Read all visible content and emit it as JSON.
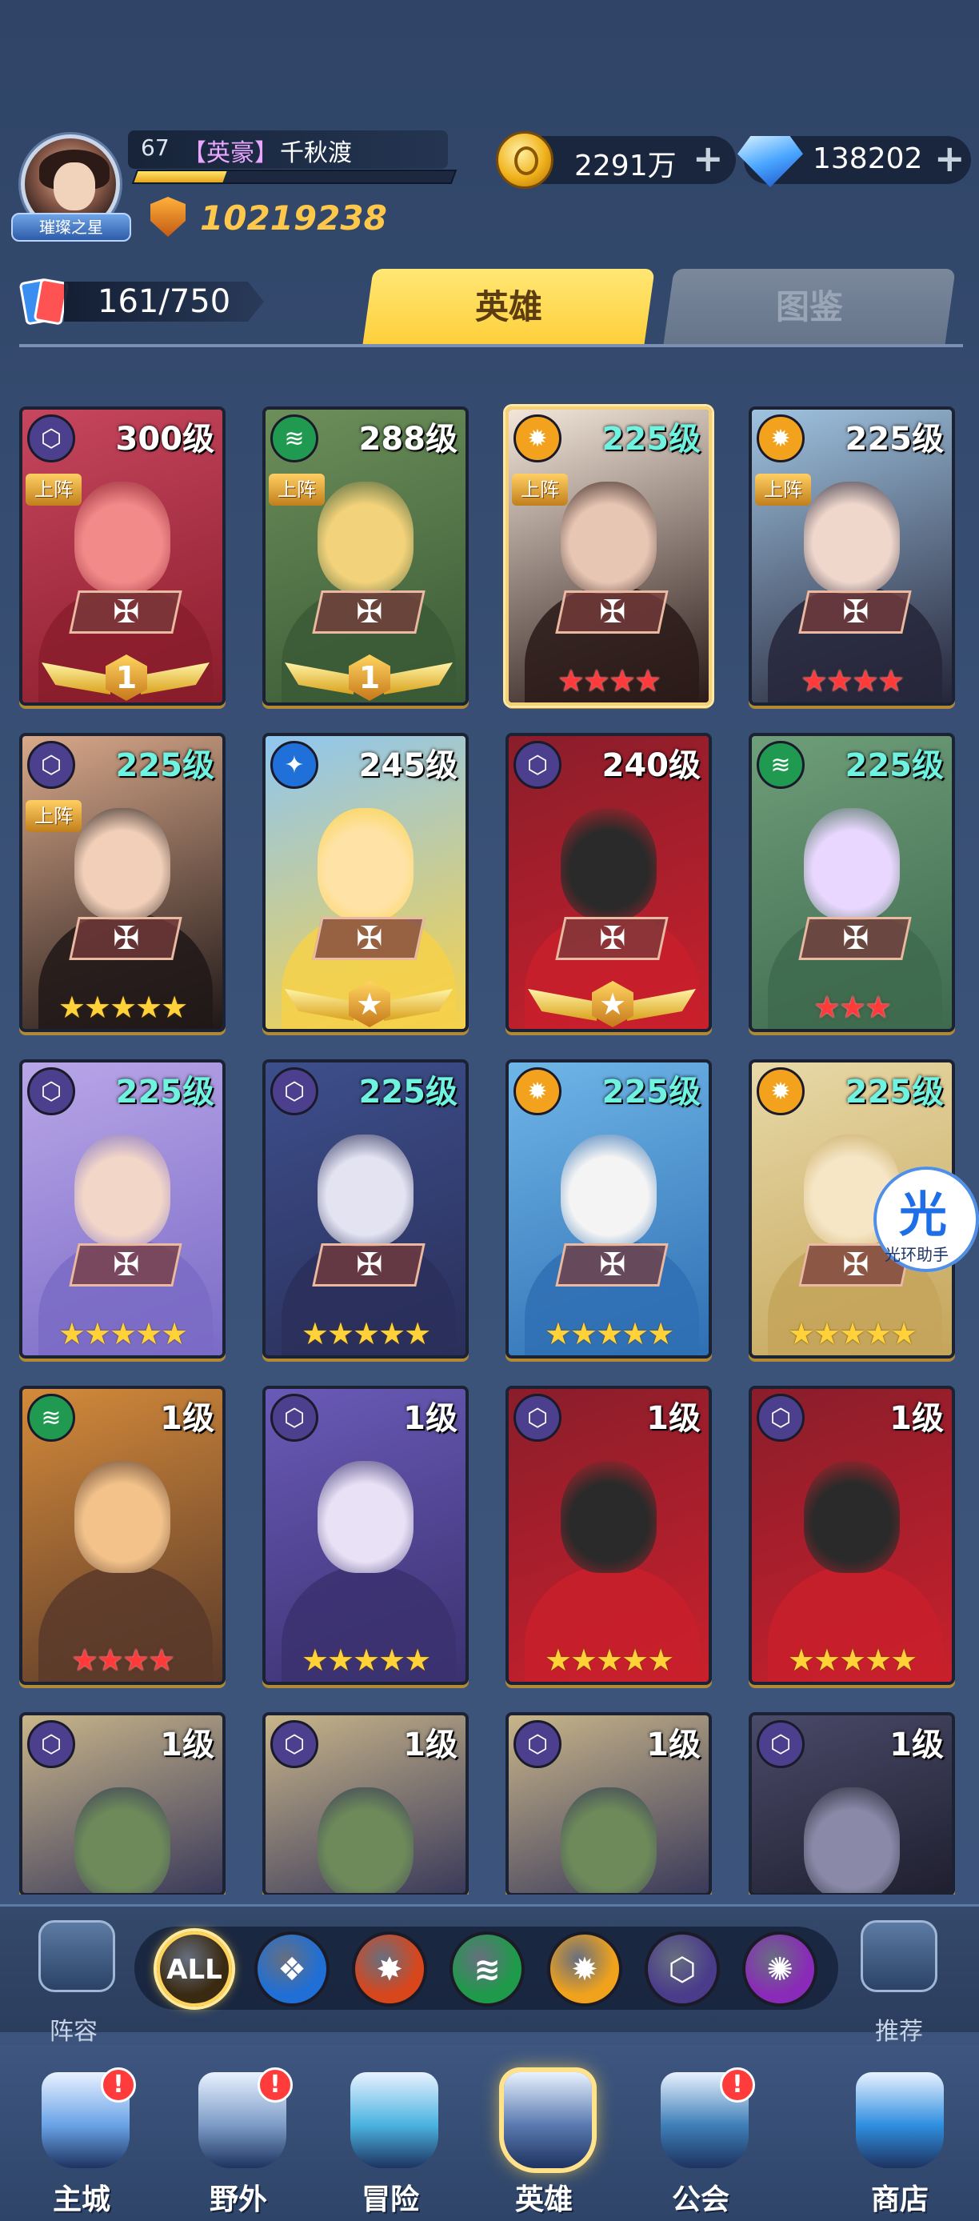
{
  "player": {
    "avatar_badge": "璀璨之星",
    "level": "67",
    "title": "【英豪】",
    "name": "千秋渡",
    "xp_fraction": 0.28,
    "power": "10219238"
  },
  "currencies": {
    "gold": "2291万",
    "gems": "138202",
    "plus_label": "+"
  },
  "collection": {
    "count": "161/750"
  },
  "tabs": [
    {
      "label": "英雄",
      "active": true
    },
    {
      "label": "图鉴",
      "active": false
    }
  ],
  "deployed_label": "上阵",
  "heroes": [
    {
      "level": "300级",
      "faction": "void",
      "deployed": true,
      "rank": "wings",
      "rank_value": "1",
      "palette": [
        "#c7465f",
        "#f28a8a",
        "#8a1d2b"
      ],
      "level_color": "white"
    },
    {
      "level": "288级",
      "faction": "wind",
      "deployed": true,
      "rank": "wings",
      "rank_value": "1",
      "palette": [
        "#6c8f5a",
        "#f2d27a",
        "#3a5a36"
      ],
      "level_color": "white"
    },
    {
      "level": "225级",
      "faction": "light",
      "deployed": true,
      "rank": "red",
      "stars": 4,
      "palette": [
        "#f3e6d9",
        "#e8c6b4",
        "#2a1a18"
      ],
      "level_color": "teal",
      "selected": true
    },
    {
      "level": "225级",
      "faction": "light",
      "deployed": true,
      "rank": "red",
      "stars": 4,
      "palette": [
        "#9fc3e0",
        "#f0d7cc",
        "#26263a"
      ],
      "level_color": "white"
    },
    {
      "level": "225级",
      "faction": "void",
      "deployed": true,
      "rank": "gold",
      "stars": 5,
      "palette": [
        "#d8a88a",
        "#f2cfb8",
        "#201818"
      ],
      "level_color": "teal"
    },
    {
      "level": "245级",
      "faction": "water",
      "deployed": false,
      "rank": "wings",
      "rank_value": "★",
      "palette": [
        "#8fc6f0",
        "#ffe3a6",
        "#f6d14a"
      ],
      "level_color": "white"
    },
    {
      "level": "240级",
      "faction": "void",
      "deployed": false,
      "rank": "wings",
      "rank_value": "★",
      "palette": [
        "#8a1d2b",
        "#2a2a2a",
        "#c8202c"
      ],
      "level_color": "white"
    },
    {
      "level": "225级",
      "faction": "wind",
      "deployed": false,
      "rank": "red",
      "stars": 3,
      "palette": [
        "#6f9e7a",
        "#e9d7ff",
        "#3e6a4e"
      ],
      "level_color": "teal"
    },
    {
      "level": "225级",
      "faction": "void",
      "deployed": false,
      "rank": "gold",
      "stars": 5,
      "palette": [
        "#b9a6e8",
        "#f2d6c8",
        "#7a6bc6"
      ],
      "level_color": "teal"
    },
    {
      "level": "225级",
      "faction": "void",
      "deployed": false,
      "rank": "gold",
      "stars": 5,
      "palette": [
        "#3d4f8c",
        "#e3e3f2",
        "#2a2f5a"
      ],
      "level_color": "teal"
    },
    {
      "level": "225级",
      "faction": "light",
      "deployed": false,
      "rank": "gold",
      "stars": 5,
      "palette": [
        "#6fb6e8",
        "#f4f4f4",
        "#2f6fb3"
      ],
      "level_color": "teal"
    },
    {
      "level": "225级",
      "faction": "light",
      "deployed": false,
      "rank": "gold",
      "stars": 5,
      "palette": [
        "#e8d9a8",
        "#f6e6c6",
        "#c4a55a"
      ],
      "level_color": "teal"
    },
    {
      "level": "1级",
      "faction": "wind",
      "deployed": false,
      "rank": "red",
      "stars": 4,
      "palette": [
        "#d48a3a",
        "#f2c28a",
        "#5a3a2a"
      ],
      "level_color": "white"
    },
    {
      "level": "1级",
      "faction": "void",
      "deployed": false,
      "rank": "gold",
      "stars": 5,
      "palette": [
        "#6a5ab8",
        "#e9e2f6",
        "#3b3170"
      ],
      "level_color": "white"
    },
    {
      "level": "1级",
      "faction": "void",
      "deployed": false,
      "rank": "gold",
      "stars": 5,
      "palette": [
        "#8a1d2b",
        "#2a2a2a",
        "#c8202c"
      ],
      "level_color": "white"
    },
    {
      "level": "1级",
      "faction": "void",
      "deployed": false,
      "rank": "gold",
      "stars": 5,
      "palette": [
        "#8a1d2b",
        "#2a2a2a",
        "#c8202c"
      ],
      "level_color": "white"
    },
    {
      "level": "1级",
      "faction": "void",
      "deployed": false,
      "rank": "none",
      "palette": [
        "#c8b58a",
        "#6e8a5a",
        "#3a3a5a"
      ],
      "level_color": "white"
    },
    {
      "level": "1级",
      "faction": "void",
      "deployed": false,
      "rank": "none",
      "palette": [
        "#c8b58a",
        "#6e8a5a",
        "#3a3a5a"
      ],
      "level_color": "white"
    },
    {
      "level": "1级",
      "faction": "void",
      "deployed": false,
      "rank": "none",
      "palette": [
        "#c8b58a",
        "#6e8a5a",
        "#3a3a5a"
      ],
      "level_color": "white"
    },
    {
      "level": "1级",
      "faction": "void",
      "deployed": false,
      "rank": "none",
      "palette": [
        "#4a4a6a",
        "#8a8aa8",
        "#1f1f2f"
      ],
      "level_color": "white"
    }
  ],
  "helper": {
    "glyph": "光",
    "label": "光环助手"
  },
  "filters": {
    "left_label": "阵容",
    "right_label": "推荐",
    "items": [
      {
        "name": "all",
        "label": "ALL",
        "color": "#3a2a12",
        "active": true
      },
      {
        "name": "water",
        "label": "",
        "color": "#1f6fd6"
      },
      {
        "name": "fire",
        "label": "",
        "color": "#d8461c"
      },
      {
        "name": "wind",
        "label": "",
        "color": "#1e9a4a"
      },
      {
        "name": "light",
        "label": "",
        "color": "#f0a21c"
      },
      {
        "name": "void",
        "label": "",
        "color": "#4a3c8a"
      },
      {
        "name": "dark",
        "label": "",
        "color": "#8a2ab8"
      }
    ]
  },
  "nav": [
    {
      "name": "main-city",
      "label": "主城",
      "badge": "!",
      "color": "#6aa3e8"
    },
    {
      "name": "wild",
      "label": "野外",
      "badge": "!",
      "color": "#7d9cc7"
    },
    {
      "name": "adventure",
      "label": "冒险",
      "badge": "",
      "color": "#4ab3e0"
    },
    {
      "name": "heroes",
      "label": "英雄",
      "badge": "",
      "color": "#5a7ab0",
      "active": true
    },
    {
      "name": "guild",
      "label": "公会",
      "badge": "!",
      "color": "#3f7fb8"
    },
    {
      "name": "shop",
      "label": "商店",
      "badge": "",
      "color": "#2f8fe0"
    }
  ],
  "colors": {
    "faction": {
      "void": "#4b3f8e",
      "wind": "#1f9a50",
      "light": "#f2a21c",
      "water": "#1f70d8"
    }
  }
}
